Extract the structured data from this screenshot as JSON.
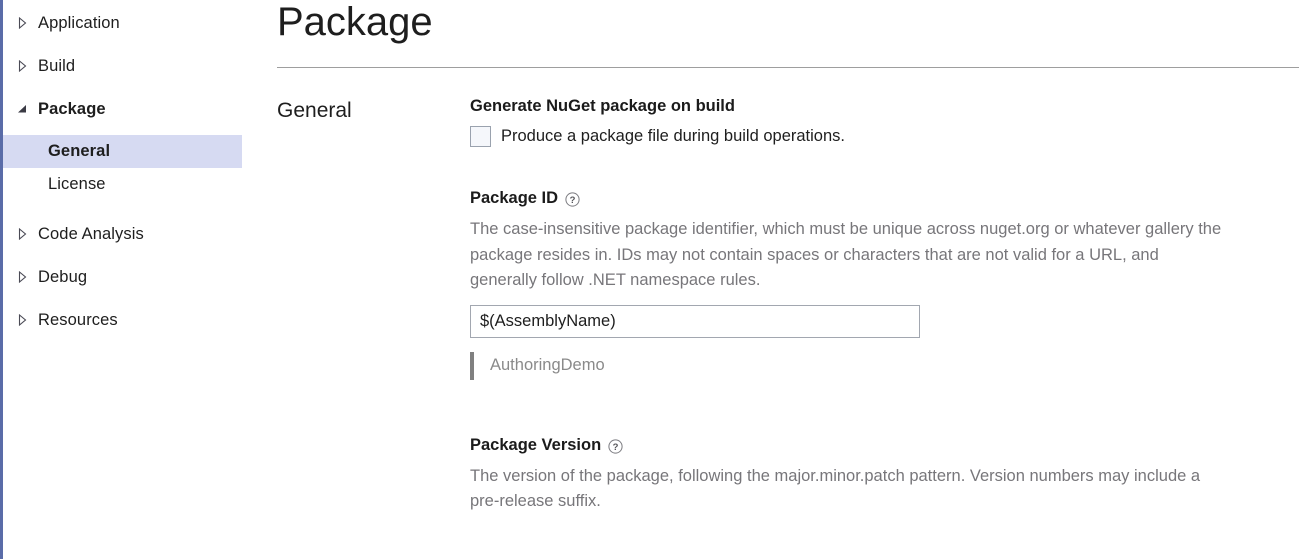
{
  "colors": {
    "accent_rail": "#5a6ca8",
    "selection_bg": "#d6daf2",
    "description_text": "#77767a",
    "evaluated_text": "#8a8a8a",
    "rule": "#9e9e9e"
  },
  "sidebar": {
    "items": [
      {
        "label": "Application",
        "state": "collapsed",
        "icon": "chevron-right-icon"
      },
      {
        "label": "Build",
        "state": "collapsed",
        "icon": "chevron-right-icon"
      },
      {
        "label": "Package",
        "state": "expanded",
        "icon": "chevron-down-icon"
      },
      {
        "label": "Code Analysis",
        "state": "collapsed",
        "icon": "chevron-right-icon"
      },
      {
        "label": "Debug",
        "state": "collapsed",
        "icon": "chevron-right-icon"
      },
      {
        "label": "Resources",
        "state": "collapsed",
        "icon": "chevron-right-icon"
      }
    ],
    "package_children": [
      {
        "label": "General",
        "selected": true
      },
      {
        "label": "License",
        "selected": false
      }
    ]
  },
  "header": {
    "title": "Package"
  },
  "main": {
    "section_label": "General",
    "generate_package": {
      "title": "Generate NuGet package on build",
      "checkbox_label": "Produce a package file during build operations.",
      "checked": false
    },
    "package_id": {
      "title": "Package ID",
      "help_icon": "help-circle-icon",
      "description": "The case-insensitive package identifier, which must be unique across nuget.org or whatever gallery the package resides in. IDs may not contain spaces or characters that are not valid for a URL, and generally follow .NET namespace rules.",
      "value": "$(AssemblyName)",
      "placeholder": "",
      "evaluated_value": "AuthoringDemo"
    },
    "package_version": {
      "title": "Package Version",
      "help_icon": "help-circle-icon",
      "description": "The version of the package, following the major.minor.patch pattern. Version numbers may include a pre-release suffix."
    }
  }
}
